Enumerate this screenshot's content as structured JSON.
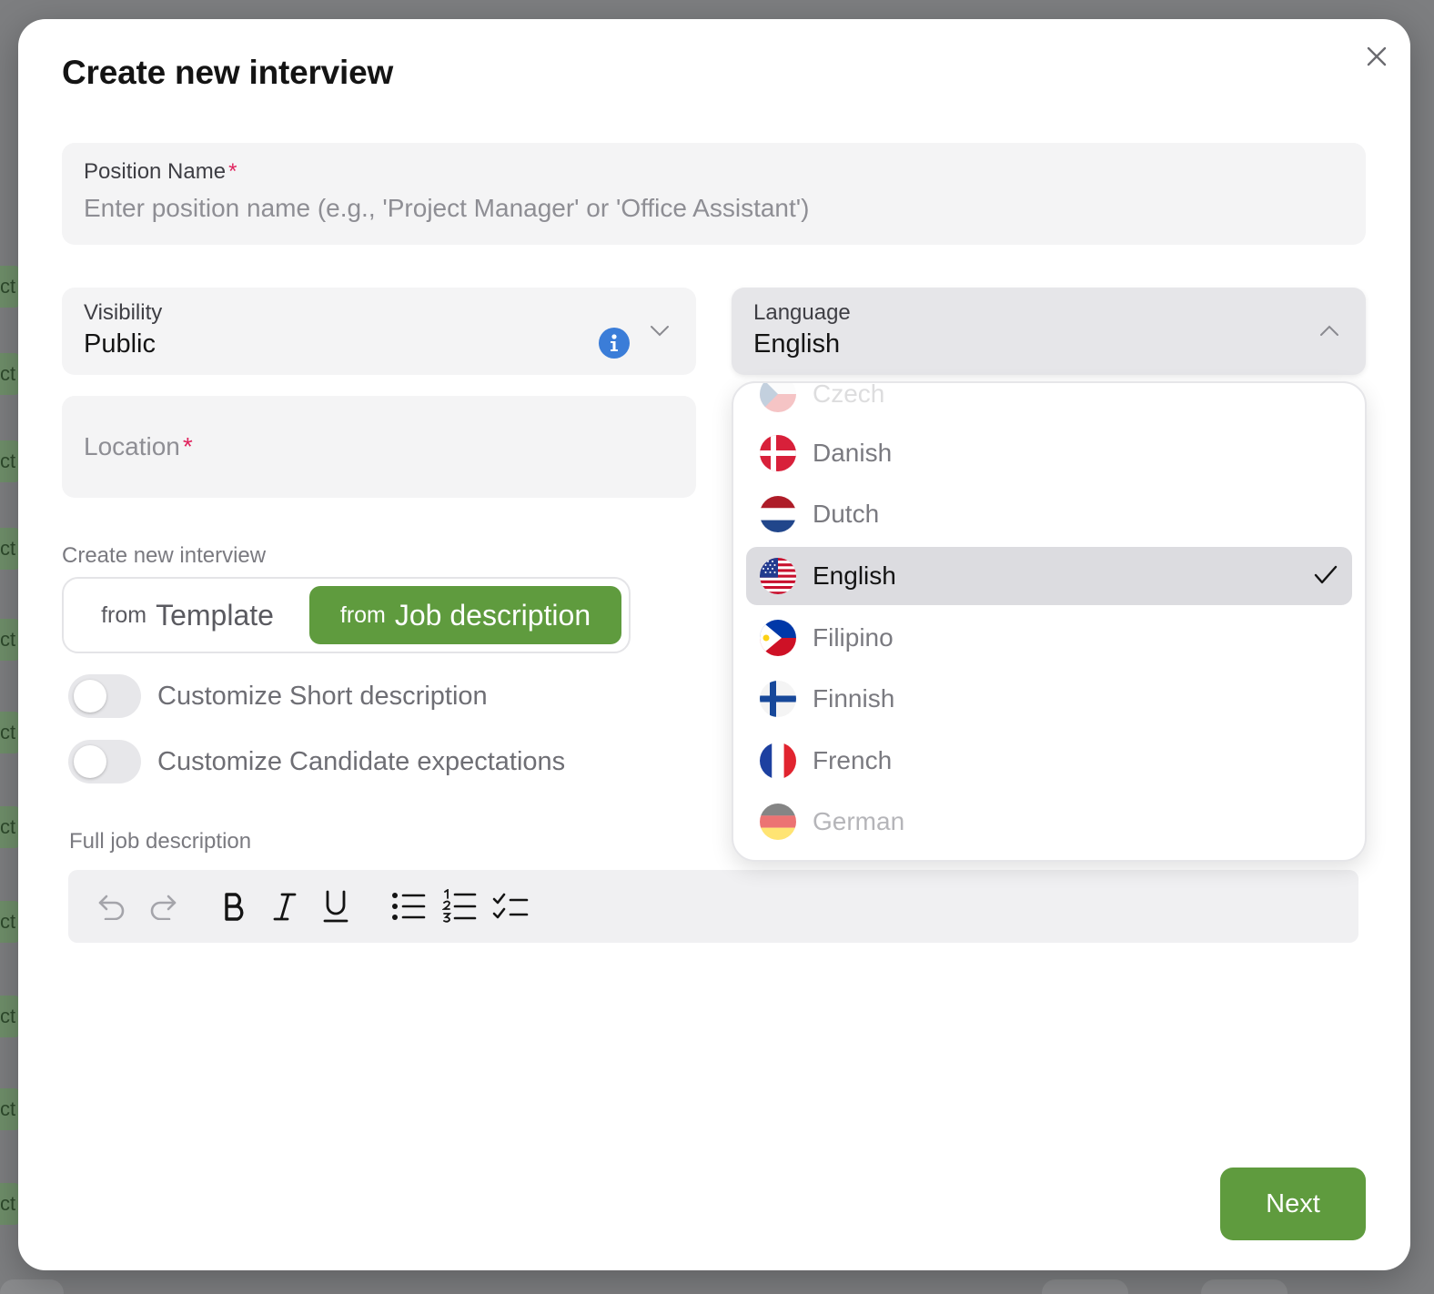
{
  "modal": {
    "title": "Create new interview"
  },
  "position_field": {
    "label": "Position Name",
    "required_mark": "*",
    "placeholder": "Enter position name (e.g., 'Project Manager' or 'Office Assistant')"
  },
  "visibility_field": {
    "label": "Visibility",
    "value": "Public"
  },
  "language_field": {
    "label": "Language",
    "value": "English"
  },
  "location_field": {
    "label": "Location",
    "required_mark": "*"
  },
  "create_mode": {
    "label": "Create new interview",
    "options": [
      {
        "prefix": "from",
        "label": "Template",
        "selected": false
      },
      {
        "prefix": "from",
        "label": "Job description",
        "selected": true
      }
    ]
  },
  "toggles": [
    {
      "label": "Customize Short description",
      "on": false
    },
    {
      "label": "Customize Candidate expectations",
      "on": false
    }
  ],
  "editor": {
    "label": "Full job description",
    "tools": [
      "undo-icon",
      "redo-icon",
      "bold-icon",
      "italic-icon",
      "underline-icon",
      "bullet-list-icon",
      "numbered-list-icon",
      "checklist-icon"
    ]
  },
  "language_dropdown": {
    "options": [
      {
        "label": "Czech",
        "flag": "czech-flag-icon"
      },
      {
        "label": "Danish",
        "flag": "danish-flag-icon"
      },
      {
        "label": "Dutch",
        "flag": "dutch-flag-icon"
      },
      {
        "label": "English",
        "flag": "us-flag-icon",
        "selected": true
      },
      {
        "label": "Filipino",
        "flag": "philippines-flag-icon"
      },
      {
        "label": "Finnish",
        "flag": "finnish-flag-icon"
      },
      {
        "label": "French",
        "flag": "french-flag-icon"
      },
      {
        "label": "German",
        "flag": "german-flag-icon"
      }
    ]
  },
  "footer": {
    "next_label": "Next"
  },
  "background": {
    "strip_text": "ct"
  },
  "colors": {
    "accent_green": "#5f9b3e",
    "info_blue": "#3b7dd8",
    "required_red": "#e0245e"
  }
}
